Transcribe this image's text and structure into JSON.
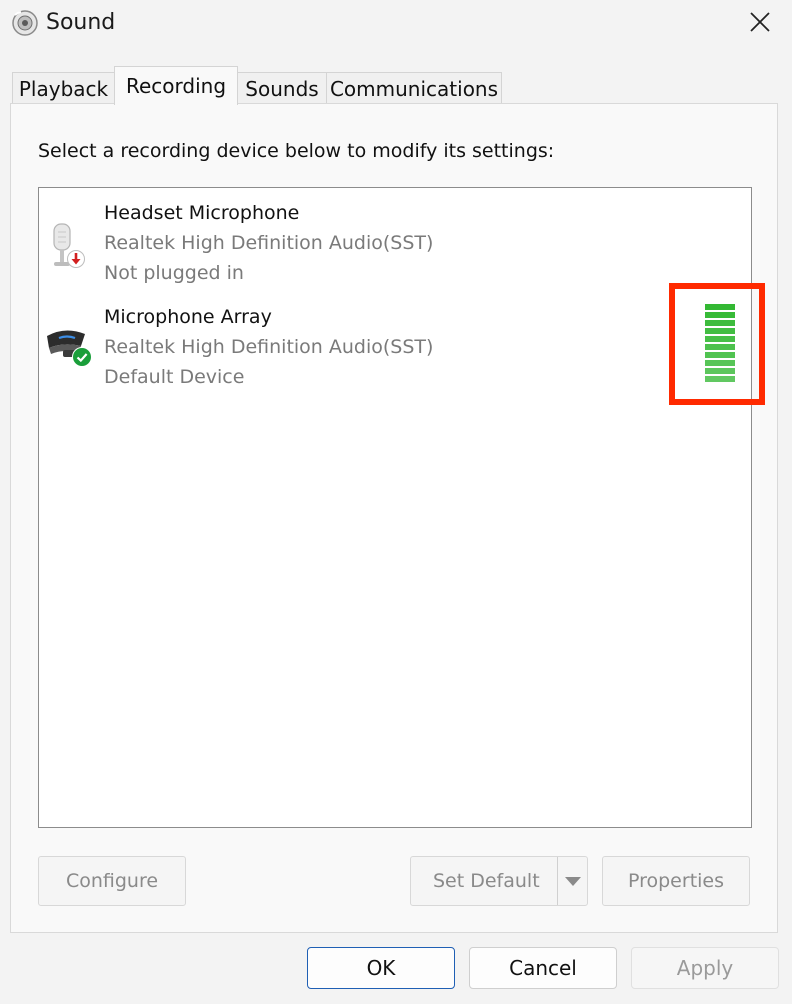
{
  "window": {
    "title": "Sound",
    "app_icon": "speaker-icon",
    "close_icon": "close-icon"
  },
  "tabs": [
    {
      "label": "Playback",
      "selected": false
    },
    {
      "label": "Recording",
      "selected": true
    },
    {
      "label": "Sounds",
      "selected": false
    },
    {
      "label": "Communications",
      "selected": false
    }
  ],
  "instruction": "Select a recording device below to modify its settings:",
  "devices": [
    {
      "name": "Headset Microphone",
      "driver": "Realtek High Definition Audio(SST)",
      "status": "Not plugged in",
      "icon": "headset-microphone-icon",
      "badge": "unplugged-arrow-icon"
    },
    {
      "name": "Microphone Array",
      "driver": "Realtek High Definition Audio(SST)",
      "status": "Default Device",
      "icon": "microphone-array-icon",
      "badge": "default-check-icon"
    }
  ],
  "level_meter": {
    "device": "Microphone Array",
    "segments_total": 10,
    "segments_lit": 10
  },
  "buttons": {
    "configure": "Configure",
    "set_default": "Set Default",
    "properties": "Properties",
    "ok": "OK",
    "cancel": "Cancel",
    "apply": "Apply"
  },
  "colors": {
    "meter_green": "#33b833",
    "highlight_red": "#ff2a00",
    "default_check_green": "#1a9e3a",
    "unplugged_red": "#d21f1f",
    "ok_border_blue": "#1f5fb4"
  }
}
